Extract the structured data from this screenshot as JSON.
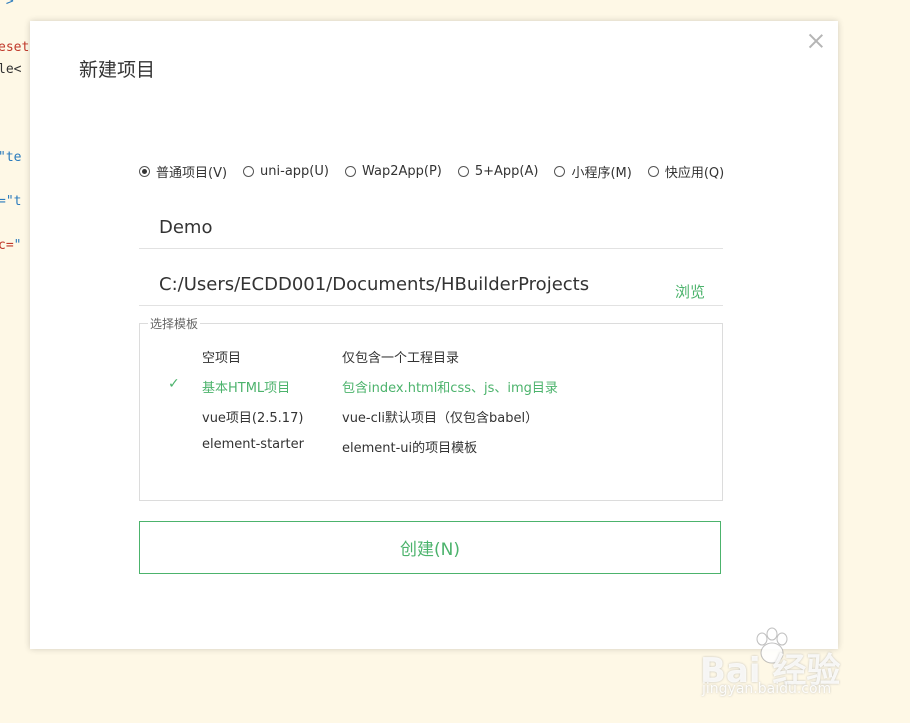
{
  "background_code": [
    {
      "prefix": "",
      "red": "",
      "str": "\">"
    },
    {
      "prefix": "",
      "red": "eset",
      "str": ""
    },
    {
      "prefix": "le<",
      "red": "",
      "str": ""
    },
    {
      "prefix": "",
      "red": "",
      "str": "\"te"
    },
    {
      "prefix": "",
      "red": "",
      "str": "=\"t"
    },
    {
      "prefix": "",
      "red": "c=",
      "str": "\""
    }
  ],
  "dialog": {
    "title": "新建项目",
    "project_types": [
      {
        "label": "普通项目(V)",
        "checked": true
      },
      {
        "label": "uni-app(U)",
        "checked": false
      },
      {
        "label": "Wap2App(P)",
        "checked": false
      },
      {
        "label": "5+App(A)",
        "checked": false
      },
      {
        "label": "小程序(M)",
        "checked": false
      },
      {
        "label": "快应用(Q)",
        "checked": false
      }
    ],
    "project_name": "Demo",
    "project_path": "C:/Users/ECDD001/Documents/HBuilderProjects",
    "browse_label": "浏览",
    "template_legend": "选择模板",
    "templates": [
      {
        "name": "空项目",
        "desc": "仅包含一个工程目录",
        "selected": false
      },
      {
        "name": "基本HTML项目",
        "desc": "包含index.html和css、js、img目录",
        "selected": true
      },
      {
        "name": "vue项目(2.5.17)",
        "desc": "vue-cli默认项目（仅包含babel）",
        "selected": false
      },
      {
        "name": "element-starter",
        "desc": "element-ui的项目模板",
        "selected": false
      }
    ],
    "check_symbol": "✓",
    "create_label": "创建(N)"
  },
  "watermark": {
    "logo": "Bai  经验",
    "sub": "jingyan.baidu.com"
  },
  "colors": {
    "accent": "#4cb36c",
    "background": "#fef8e6"
  }
}
